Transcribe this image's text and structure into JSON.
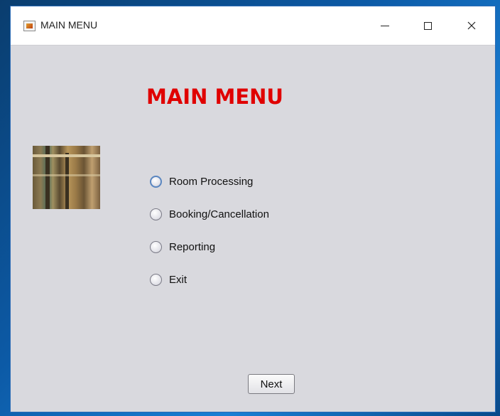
{
  "window": {
    "title": "MAIN MENU",
    "controls": {
      "minimize": "minimize",
      "maximize": "maximize",
      "close": "close"
    }
  },
  "main": {
    "heading": "MAIN MENU",
    "heading_color": "#e00000",
    "thumbnail": "photo-thumbnail",
    "options": [
      {
        "label": "Room Processing",
        "selected": false,
        "focused": true
      },
      {
        "label": "Booking/Cancellation",
        "selected": false,
        "focused": false
      },
      {
        "label": "Reporting",
        "selected": false,
        "focused": false
      },
      {
        "label": "Exit",
        "selected": false,
        "focused": false
      }
    ],
    "next_label": "Next"
  }
}
